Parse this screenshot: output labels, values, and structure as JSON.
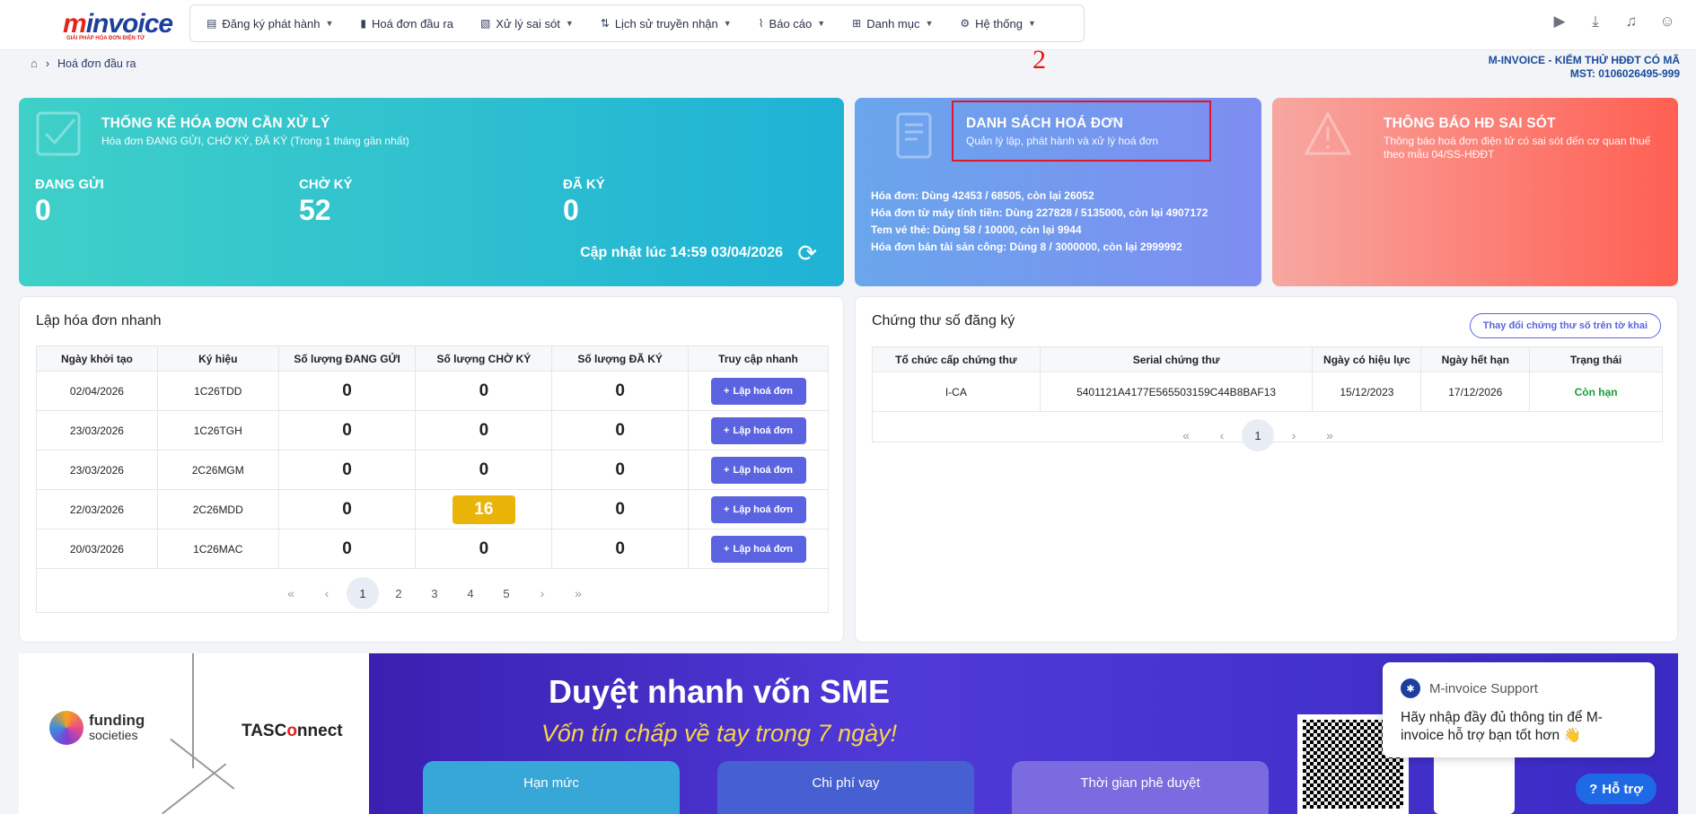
{
  "brand": {
    "logo_text_a": "m",
    "logo_text_b": "invoice",
    "logo_sub": "GIẢI PHÁP HÓA ĐƠN ĐIỆN TỬ"
  },
  "nav": [
    {
      "label": "Đăng ký phát hành",
      "icon": "file-edit-icon",
      "dropdown": true
    },
    {
      "label": "Hoá đơn đầu ra",
      "icon": "document-icon",
      "dropdown": false
    },
    {
      "label": "Xử lý sai sót",
      "icon": "file-fix-icon",
      "dropdown": true
    },
    {
      "label": "Lịch sử truyền nhận",
      "icon": "sort-arrows-icon",
      "dropdown": true
    },
    {
      "label": "Báo cáo",
      "icon": "chart-icon",
      "dropdown": true
    },
    {
      "label": "Danh mục",
      "icon": "grid-icon",
      "dropdown": true
    },
    {
      "label": "Hệ thống",
      "icon": "gear-icon",
      "dropdown": true
    }
  ],
  "topicons": [
    "youtube-icon",
    "download-icon",
    "bell-icon",
    "user-icon"
  ],
  "breadcrumb": {
    "current": "Hoá đơn đầu ra"
  },
  "annotation": {
    "step": "2"
  },
  "company": {
    "name": "M-INVOICE - KIỂM THỬ HĐĐT CÓ MÃ",
    "mst": "MST: 0106026495-999"
  },
  "stats_card": {
    "title": "THỐNG KÊ HÓA ĐƠN CẦN XỬ LÝ",
    "subtitle": "Hóa đơn ĐANG GỬI, CHỜ KÝ, ĐÃ KÝ (Trong 1 tháng gần nhất)",
    "items": [
      {
        "label": "ĐANG GỬI",
        "value": "0"
      },
      {
        "label": "CHỜ KÝ",
        "value": "52"
      },
      {
        "label": "ĐÃ KÝ",
        "value": "0"
      }
    ],
    "updated": "Cập nhật lúc 14:59 03/04/2026"
  },
  "list_card": {
    "title": "DANH SÁCH HOÁ ĐƠN",
    "subtitle": "Quản lý lập, phát hành và xử lý hoá đơn",
    "quota": [
      "Hóa đơn: Dùng 42453 / 68505, còn lại 26052",
      "Hóa đơn từ máy tính tiền: Dùng 227828 / 5135000, còn lại 4907172",
      "Tem vé thẻ: Dùng 58 / 10000, còn lại 9944",
      "Hóa đơn bán tài sản công: Dùng 8 / 3000000, còn lại 2999992"
    ]
  },
  "error_card": {
    "title": "THÔNG BÁO HĐ SAI SÓT",
    "subtitle": "Thông báo hoá đơn điện tử có sai sót đến cơ quan thuế theo mẫu 04/SS-HĐĐT"
  },
  "quick": {
    "title": "Lập hóa đơn nhanh",
    "headers": [
      "Ngày khởi tạo",
      "Ký hiệu",
      "Số lượng ĐANG GỬI",
      "Số lượng CHỜ KÝ",
      "Số lượng ĐÃ KÝ",
      "Truy cập nhanh"
    ],
    "button_label": "Lập hoá đơn",
    "rows": [
      {
        "date": "02/04/2026",
        "code": "1C26TDD",
        "sending": "0",
        "waiting": "0",
        "signed": "0",
        "hl": false
      },
      {
        "date": "23/03/2026",
        "code": "1C26TGH",
        "sending": "0",
        "waiting": "0",
        "signed": "0",
        "hl": false
      },
      {
        "date": "23/03/2026",
        "code": "2C26MGM",
        "sending": "0",
        "waiting": "0",
        "signed": "0",
        "hl": false
      },
      {
        "date": "22/03/2026",
        "code": "2C26MDD",
        "sending": "0",
        "waiting": "16",
        "signed": "0",
        "hl": true
      },
      {
        "date": "20/03/2026",
        "code": "1C26MAC",
        "sending": "0",
        "waiting": "0",
        "signed": "0",
        "hl": false
      }
    ],
    "pages": [
      "1",
      "2",
      "3",
      "4",
      "5"
    ]
  },
  "cert": {
    "title": "Chứng thư số đăng ký",
    "change_label": "Thay đổi chứng thư số trên tờ khai",
    "headers": [
      "Tổ chức cấp chứng thư",
      "Serial chứng thư",
      "Ngày có hiệu lực",
      "Ngày hết hạn",
      "Trạng thái"
    ],
    "rows": [
      {
        "issuer": "I-CA",
        "serial": "5401121A4177E565503159C44B8BAF13",
        "from": "15/12/2023",
        "to": "17/12/2026",
        "status": "Còn hạn"
      }
    ],
    "pages": [
      "1"
    ]
  },
  "banner": {
    "title": "Duyệt nhanh vốn SME",
    "subtitle": "Vốn tín chấp về tay trong 7 ngày!",
    "partner1_a": "funding",
    "partner1_b": "societies",
    "partner2_a": "TASC",
    "partner2_b": "o",
    "partner2_c": "nnect",
    "pills": [
      "Hạn mức",
      "Chi phí vay",
      "Thời gian phê duyệt"
    ],
    "colors": {
      "bg": "#3b2ac4",
      "accent": "#f7d44a"
    }
  },
  "chat": {
    "name": "M-invoice Support",
    "message": "Hãy nhập đầy đủ thông tin để M-invoice hỗ trợ bạn tốt hơn 👋",
    "help_label": "Hỗ trợ"
  }
}
